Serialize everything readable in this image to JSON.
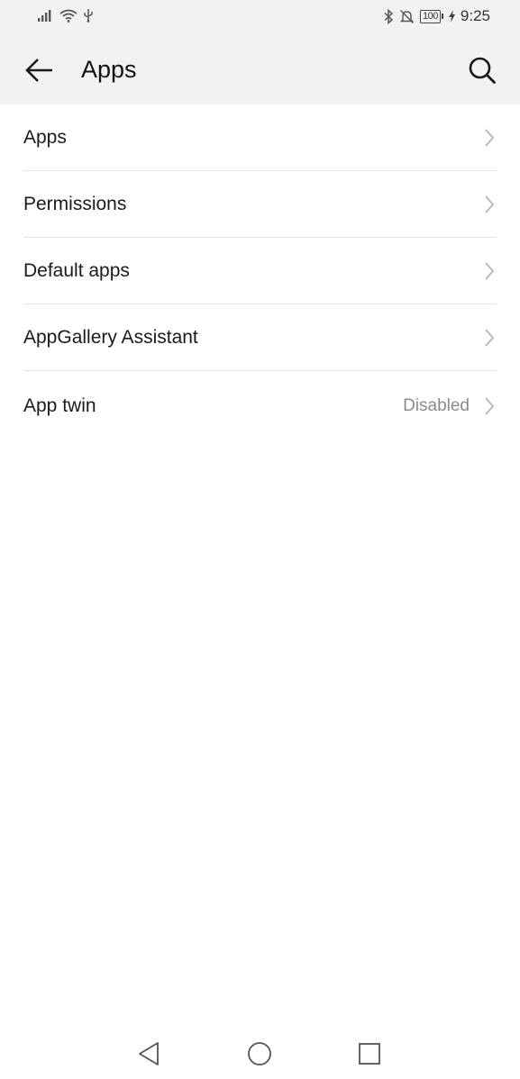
{
  "status_bar": {
    "icons_left": [
      "signal-icon",
      "wifi-icon",
      "usb-icon"
    ],
    "icons_right": [
      "bluetooth-icon",
      "mute-icon"
    ],
    "battery": "100",
    "time": "9:25"
  },
  "app_bar": {
    "title": "Apps",
    "back_icon": "back-arrow-icon",
    "search_icon": "search-icon"
  },
  "list": {
    "items": [
      {
        "label": "Apps",
        "value": ""
      },
      {
        "label": "Permissions",
        "value": ""
      },
      {
        "label": "Default apps",
        "value": ""
      },
      {
        "label": "AppGallery Assistant",
        "value": ""
      },
      {
        "label": "App twin",
        "value": "Disabled"
      }
    ]
  },
  "nav_bar": {
    "buttons": [
      "nav-back-icon",
      "nav-home-icon",
      "nav-recents-icon"
    ]
  },
  "colors": {
    "header_bg": "#f2f2f2",
    "text": "#1a1a1a",
    "secondary_text": "#8a8a8a",
    "divider": "#e3e3e3"
  }
}
